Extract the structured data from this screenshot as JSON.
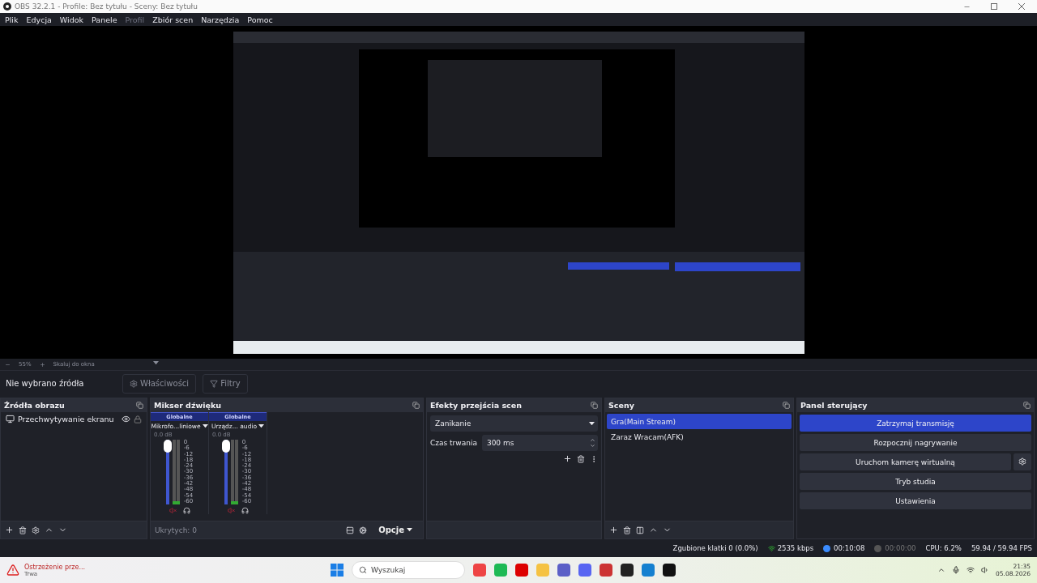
{
  "window": {
    "title": "OBS 32.2.1 - Profile: Bez tytułu - Sceny: Bez tytułu"
  },
  "menu": [
    {
      "label": "Plik",
      "disabled": false
    },
    {
      "label": "Edycja",
      "disabled": false
    },
    {
      "label": "Widok",
      "disabled": false
    },
    {
      "label": "Panele",
      "disabled": false
    },
    {
      "label": "Profil",
      "disabled": true
    },
    {
      "label": "Zbiór scen",
      "disabled": false
    },
    {
      "label": "Narzędzia",
      "disabled": false
    },
    {
      "label": "Pomoc",
      "disabled": false
    }
  ],
  "zoom_bar": {
    "zoom": "55%",
    "scale_mode": "Skaluj do okna"
  },
  "source_bar": {
    "status": "Nie wybrano źródła",
    "properties": "Właściwości",
    "filters": "Filtry"
  },
  "sources": {
    "title": "Źródła obrazu",
    "items": [
      {
        "name": "Przechwytywanie ekranu",
        "visible": true,
        "locked": true
      }
    ]
  },
  "mixer": {
    "title": "Mikser dźwięku",
    "channels": [
      {
        "group": "Globalne",
        "name": "Mikrofo...liniowe",
        "reading": "0.0 dB",
        "level": 1,
        "muted": true,
        "ticks": [
          "0",
          "-6",
          "-12",
          "-18",
          "-24",
          "-30",
          "-36",
          "-42",
          "-48",
          "-54",
          "-60"
        ]
      },
      {
        "group": "Globalne",
        "name": "Urządz... audio",
        "reading": "0.0 dB",
        "level": 1,
        "muted": true,
        "ticks": [
          "0",
          "-6",
          "-12",
          "-18",
          "-24",
          "-30",
          "-36",
          "-42",
          "-48",
          "-54",
          "-60"
        ]
      }
    ],
    "hidden": "Ukrytych: 0",
    "options": "Opcje"
  },
  "transitions": {
    "title": "Efekty przejścia scen",
    "selected": "Zanikanie",
    "duration_label": "Czas trwania",
    "duration": "300 ms"
  },
  "scenes": {
    "title": "Sceny",
    "items": [
      {
        "name": "Gra(Main Stream)",
        "selected": true
      },
      {
        "name": "Zaraz Wracam(AFK)",
        "selected": false
      }
    ]
  },
  "controls": {
    "title": "Panel sterujący",
    "buttons": [
      {
        "label": "Zatrzymaj transmisję",
        "kind": "plain",
        "active": true
      },
      {
        "label": "Rozpocznij nagrywanie",
        "kind": "plain",
        "active": false
      },
      {
        "label": "Uruchom kamerę wirtualną",
        "kind": "with_settings",
        "active": false
      },
      {
        "label": "Tryb studia",
        "kind": "plain",
        "active": false
      },
      {
        "label": "Ustawienia",
        "kind": "plain",
        "active": false
      }
    ]
  },
  "status_bar": {
    "dropped_frames": "Zgubione klatki 0 (0.0%)",
    "bitrate": "2535 kbps",
    "stream_time": "00:10:08",
    "streaming": true,
    "record_time": "00:00:00",
    "recording": false,
    "cpu": "CPU: 6.2%",
    "fps": "59.94 / 59.94 FPS"
  },
  "taskbar": {
    "notification_title": "Ostrzeżenie prze...",
    "notification_subtitle": "Trwa",
    "search_placeholder": "Wyszukaj",
    "time": "21:35",
    "date": "05.08.2026"
  }
}
